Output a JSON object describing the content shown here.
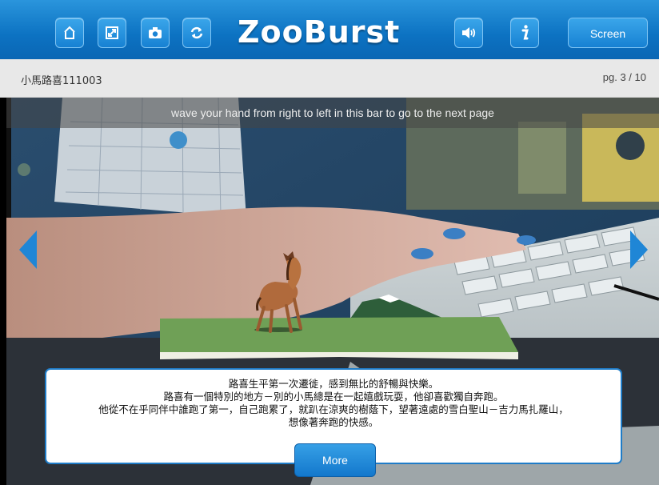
{
  "app": {
    "logo": "ZooBurst"
  },
  "toolbar": {
    "buttons": [
      {
        "icon": "home-icon"
      },
      {
        "icon": "expand-icon"
      },
      {
        "icon": "camera-icon"
      },
      {
        "icon": "refresh-icon"
      },
      {
        "icon": "sound-icon"
      },
      {
        "icon": "info-icon"
      }
    ],
    "screen_label": "Screen"
  },
  "book": {
    "title": "小馬路喜111003",
    "page": "pg. 3 / 10"
  },
  "scene": {
    "hint": "wave your hand from right to left in this bar to go to the next page",
    "story_lines": [
      "路喜生平第一次遷徙，感到無比的舒暢與快樂。",
      "路喜有一個特別的地方－別的小馬總是在一起嬉戲玩耍，他卻喜歡獨自奔跑。",
      "他從不在乎同伴中誰跑了第一，自己跑累了，就趴在涼爽的樹蔭下，望著遠處的雪白聖山－吉力馬扎羅山，",
      "想像著奔跑的快感。"
    ],
    "more_label": "More"
  },
  "colors": {
    "accent": "#1781d3",
    "panel_border": "#1f7cc8"
  }
}
